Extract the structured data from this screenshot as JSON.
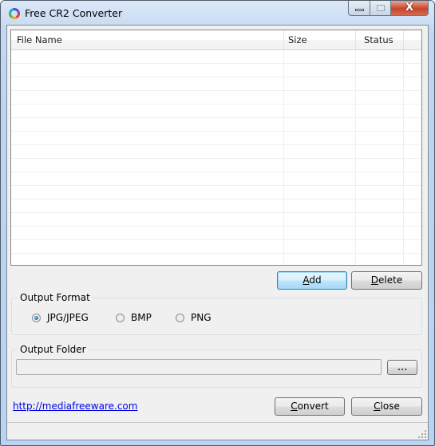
{
  "window": {
    "title": "Free CR2 Converter",
    "icon": "app-ring-icon",
    "controls": [
      "minimize",
      "maximize",
      "close"
    ]
  },
  "file_list": {
    "columns": [
      {
        "label": "File Name"
      },
      {
        "label": "Size"
      },
      {
        "label": "Status"
      },
      {
        "label": ""
      }
    ],
    "rows": []
  },
  "buttons": {
    "add": {
      "label": "Add",
      "mnemonic": "A",
      "rest": "dd"
    },
    "delete": {
      "label": "Delete",
      "mnemonic": "D",
      "rest": "elete"
    },
    "browse": {
      "label": "..."
    },
    "convert": {
      "label": "Convert",
      "mnemonic": "C",
      "rest": "onvert"
    },
    "close": {
      "label": "Close",
      "mnemonic": "C",
      "rest": "lose"
    }
  },
  "output_format": {
    "label": "Output Format",
    "options": [
      {
        "label": "JPG/JPEG",
        "checked": true
      },
      {
        "label": "BMP",
        "checked": false
      },
      {
        "label": "PNG",
        "checked": false
      }
    ],
    "selected": "JPG/JPEG"
  },
  "output_folder": {
    "label": "Output Folder",
    "value": "",
    "placeholder": ""
  },
  "footer": {
    "link_text": "http://mediafreeware.com"
  },
  "colors": {
    "link": "#0000ee",
    "default_button_border": "#3c7fb1",
    "radio_checked": "#1b6fa6"
  }
}
